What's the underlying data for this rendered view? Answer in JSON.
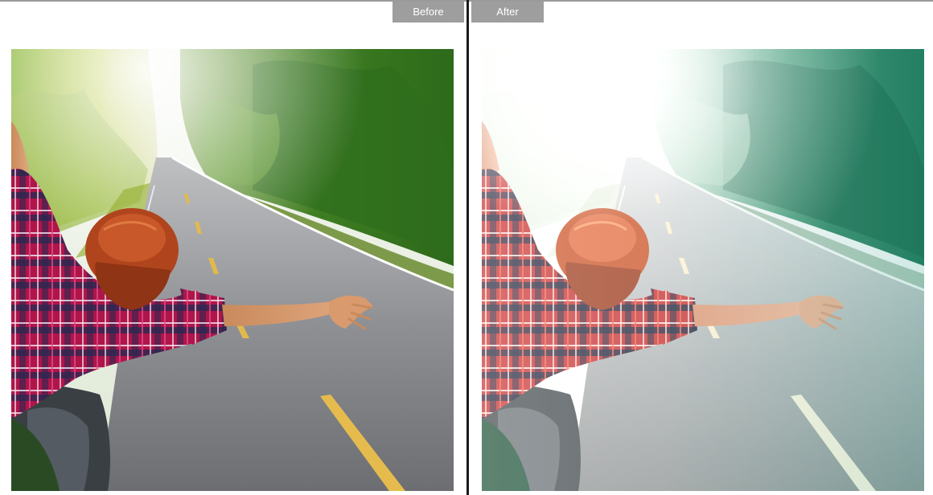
{
  "labels": {
    "before": "Before",
    "after": "After"
  },
  "panels": [
    {
      "id": "before",
      "image": "road-trip-photo-original"
    },
    {
      "id": "after",
      "image": "road-trip-photo-edited"
    }
  ]
}
